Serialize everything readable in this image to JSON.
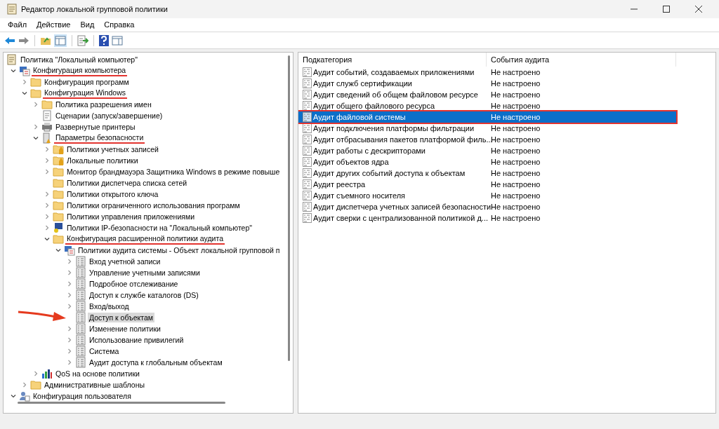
{
  "window": {
    "title": "Редактор локальной групповой политики"
  },
  "menu": [
    "Файл",
    "Действие",
    "Вид",
    "Справка"
  ],
  "tree": [
    {
      "label": "Политика \"Локальный компьютер\"",
      "kind": "policy-doc",
      "children": [
        {
          "label": "Конфигурация компьютера",
          "kind": "computer",
          "expanded": true,
          "underlined": true,
          "children": [
            {
              "label": "Конфигурация программ",
              "kind": "folder",
              "expanded": false
            },
            {
              "label": "Конфигурация Windows",
              "kind": "folder",
              "expanded": true,
              "underlined": true,
              "children": [
                {
                  "label": "Политика разрешения имен",
                  "kind": "folder",
                  "expanded": false
                },
                {
                  "label": "Сценарии (запуск/завершение)",
                  "kind": "script"
                },
                {
                  "label": "Развернутые принтеры",
                  "kind": "printer",
                  "expanded": false
                },
                {
                  "label": "Параметры безопасности",
                  "kind": "security",
                  "expanded": true,
                  "underlined": true,
                  "children": [
                    {
                      "label": "Политики учетных записей",
                      "kind": "folder-lock",
                      "expanded": false
                    },
                    {
                      "label": "Локальные политики",
                      "kind": "folder-lock",
                      "expanded": false
                    },
                    {
                      "label": "Монитор брандмауэра Защитника Windows в режиме повыше",
                      "kind": "folder",
                      "expanded": false
                    },
                    {
                      "label": "Политики диспетчера списка сетей",
                      "kind": "folder"
                    },
                    {
                      "label": "Политики открытого ключа",
                      "kind": "folder",
                      "expanded": false
                    },
                    {
                      "label": "Политики ограниченного использования программ",
                      "kind": "folder",
                      "expanded": false
                    },
                    {
                      "label": "Политики управления приложениями",
                      "kind": "folder",
                      "expanded": false
                    },
                    {
                      "label": "Политики IP-безопасности на \"Локальный компьютер\"",
                      "kind": "ip-security",
                      "expanded": false
                    },
                    {
                      "label": "Конфигурация расширенной политики аудита",
                      "kind": "folder",
                      "expanded": true,
                      "underlined": true,
                      "children": [
                        {
                          "label": "Политики аудита системы - Объект локальной групповой п",
                          "kind": "computer",
                          "expanded": true,
                          "children": [
                            {
                              "label": "Вход учетной записи",
                              "kind": "audit",
                              "expanded": false,
                              "selected": false
                            },
                            {
                              "label": "Управление учетными записями",
                              "kind": "audit",
                              "expanded": false,
                              "selected": false
                            },
                            {
                              "label": "Подробное отслеживание",
                              "kind": "audit",
                              "expanded": false,
                              "selected": false
                            },
                            {
                              "label": "Доступ к службе каталогов (DS)",
                              "kind": "audit",
                              "expanded": false,
                              "selected": false
                            },
                            {
                              "label": "Вход/выход",
                              "kind": "audit",
                              "expanded": false,
                              "selected": false
                            },
                            {
                              "label": "Доступ к объектам",
                              "kind": "audit",
                              "selected": true,
                              "arrow": true
                            },
                            {
                              "label": "Изменение политики",
                              "kind": "audit",
                              "expanded": false,
                              "selected": false
                            },
                            {
                              "label": "Использование привилегий",
                              "kind": "audit",
                              "expanded": false,
                              "selected": false
                            },
                            {
                              "label": "Система",
                              "kind": "audit",
                              "expanded": false,
                              "selected": false
                            },
                            {
                              "label": "Аудит доступа к глобальным объектам",
                              "kind": "audit",
                              "expanded": false,
                              "selected": false
                            }
                          ]
                        }
                      ]
                    }
                  ]
                },
                {
                  "label": "QoS на основе политики",
                  "kind": "qos",
                  "expanded": false
                }
              ]
            },
            {
              "label": "Административные шаблоны",
              "kind": "folder",
              "expanded": false
            }
          ]
        },
        {
          "label": "Конфигурация пользователя",
          "kind": "user",
          "expanded": true
        }
      ]
    }
  ],
  "table": {
    "columns": [
      "Подкатегория",
      "События аудита"
    ],
    "rows": [
      {
        "name": "Аудит событий, создаваемых приложениями",
        "status": "Не настроено",
        "selected": false
      },
      {
        "name": "Аудит служб сертификации",
        "status": "Не настроено",
        "selected": false
      },
      {
        "name": "Аудит сведений об общем файловом ресурсе",
        "status": "Не настроено",
        "selected": false
      },
      {
        "name": "Аудит общего файлового ресурса",
        "status": "Не настроено",
        "selected": false
      },
      {
        "name": "Аудит файловой системы",
        "status": "Не настроено",
        "selected": true,
        "framed": true
      },
      {
        "name": "Аудит подключения платформы фильтрации",
        "status": "Не настроено",
        "selected": false
      },
      {
        "name": "Аудит отбрасывания пакетов платформой филь...",
        "status": "Не настроено",
        "selected": false
      },
      {
        "name": "Аудит работы с дескрипторами",
        "status": "Не настроено",
        "selected": false
      },
      {
        "name": "Аудит объектов ядра",
        "status": "Не настроено",
        "selected": false
      },
      {
        "name": "Аудит других событий доступа к объектам",
        "status": "Не настроено",
        "selected": false
      },
      {
        "name": "Аудит реестра",
        "status": "Не настроено",
        "selected": false
      },
      {
        "name": "Аудит съемного носителя",
        "status": "Не настроено",
        "selected": false
      },
      {
        "name": "Аудит диспетчера учетных записей безопасности",
        "status": "Не настроено",
        "selected": false
      },
      {
        "name": "Аудит сверки с централизованной политикой д...",
        "status": "Не настроено",
        "selected": false
      }
    ]
  }
}
